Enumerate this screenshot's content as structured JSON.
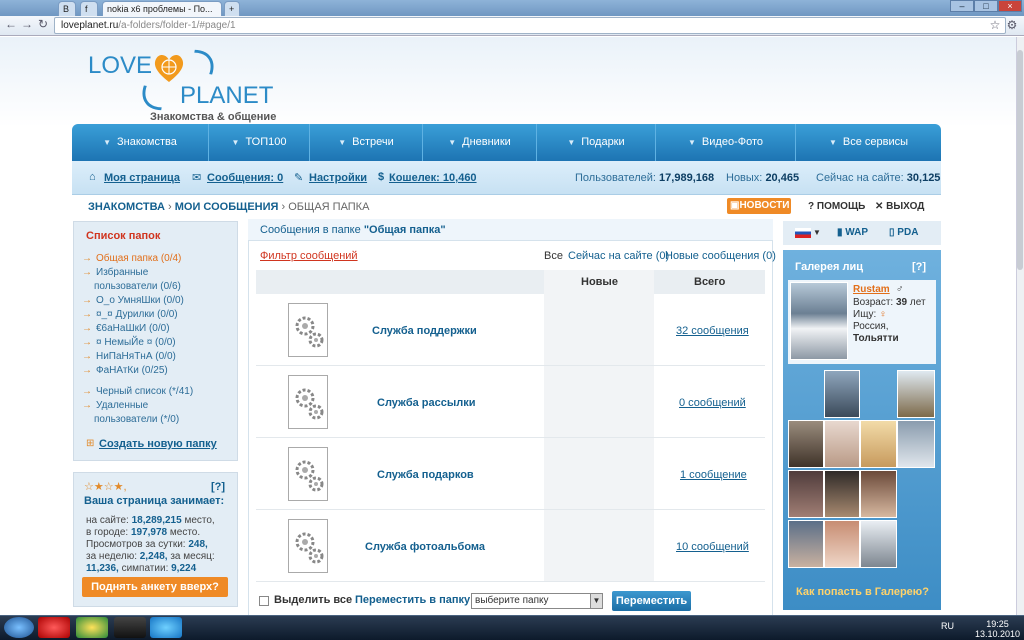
{
  "browser": {
    "tabs": [
      "В",
      "f",
      "nokia x6 проблемы - По...",
      "+"
    ],
    "url_host": "loveplanet.ru",
    "url_path": "/a-folders/folder-1/#page/1"
  },
  "logo": {
    "love": "LOVE",
    "planet": "PLANET",
    "tagline": "Знакомства & общение"
  },
  "menu": [
    "Знакомства",
    "ТОП100",
    "Встречи",
    "Дневники",
    "Подарки",
    "Видео-Фото",
    "Все сервисы"
  ],
  "subbar": {
    "my_page": "Моя страница",
    "messages": "Сообщения: 0",
    "settings": "Настройки",
    "wallet": "Кошелек: 10,460",
    "users_label": "Пользователей:",
    "users_value": "17,989,168",
    "new_label": "Новых:",
    "new_value": "20,465",
    "online_label": "Сейчас на сайте:",
    "online_value": "30,125"
  },
  "breadcrumb": {
    "item1": "ЗНАКОМСТВА",
    "sep": "›",
    "item2": "МОИ СООБЩЕНИЯ",
    "item3": "ОБЩАЯ ПАПКА"
  },
  "top_right": {
    "news": "НОВОСТИ",
    "help": "ПОМОЩЬ",
    "exit": "ВЫХОД",
    "wap": "WAP",
    "pda": "PDA"
  },
  "folders": {
    "title": "Список папок",
    "items": [
      "Общая папка (0/4)",
      "Избранные",
      "пользователи (0/6)",
      "О_о УмняШки (0/0)",
      "¤_¤ Дурилки (0/0)",
      "€6аНаШкИ (0/0)",
      "¤ НемыЙе ¤ (0/0)",
      "НиПаНяТнА (0/0)",
      "ФаНАтКи (0/25)",
      "Черный список (*/41)",
      "Удаленные",
      "пользователи (*/0)"
    ],
    "create": "Создать новую папку"
  },
  "rank": {
    "stars": "☆★☆★,",
    "q": "[?]",
    "title": "Ваша страница занимает:",
    "line1_label": "на сайте:",
    "line1_value": "18,289,215",
    "line1_suffix": "место,",
    "line2_label": "в городе:",
    "line2_value": "197,978",
    "line2_suffix": "место.",
    "line3": "Просмотров за сутки:",
    "line3_value": "248,",
    "line4_label": "за неделю:",
    "line4_value": "2,248,",
    "line4_label2": "за месяц:",
    "line5_value": "11,236,",
    "line5_label": "симпатии:",
    "line5_value2": "9,224",
    "button": "Поднять анкету вверх?"
  },
  "main": {
    "header_prefix": "Сообщения в папке",
    "header_folder": "\"Общая папка\"",
    "filter": "Фильтр сообщений",
    "filter_all": "Все",
    "filter_online": "Сейчас на сайте (0)",
    "filter_new": "Новые сообщения (0)",
    "col_new": "Новые",
    "col_total": "Всего",
    "rows": [
      {
        "name": "Служба поддержки",
        "count": "32 сообщения"
      },
      {
        "name": "Служба рассылки",
        "count": "0 сообщений"
      },
      {
        "name": "Служба подарков",
        "count": "1 сообщение"
      },
      {
        "name": "Служба фотоальбома",
        "count": "10 сообщений"
      }
    ],
    "select_all": "Выделить все",
    "move_to": "Переместить в папку:",
    "select_placeholder": "выберите папку",
    "move_button": "Переместить"
  },
  "gallery": {
    "title": "Галерея лиц",
    "q": "[?]",
    "name": "Rustam",
    "age_label": "Возраст:",
    "age": "39",
    "age_suffix": "лет",
    "seek_label": "Ищу:",
    "country": "Россия,",
    "city": "Тольятти",
    "footer": "Как попасть в Галерею?"
  },
  "taskbar": {
    "lang": "RU",
    "time": "19:25",
    "date": "13.10.2010"
  }
}
